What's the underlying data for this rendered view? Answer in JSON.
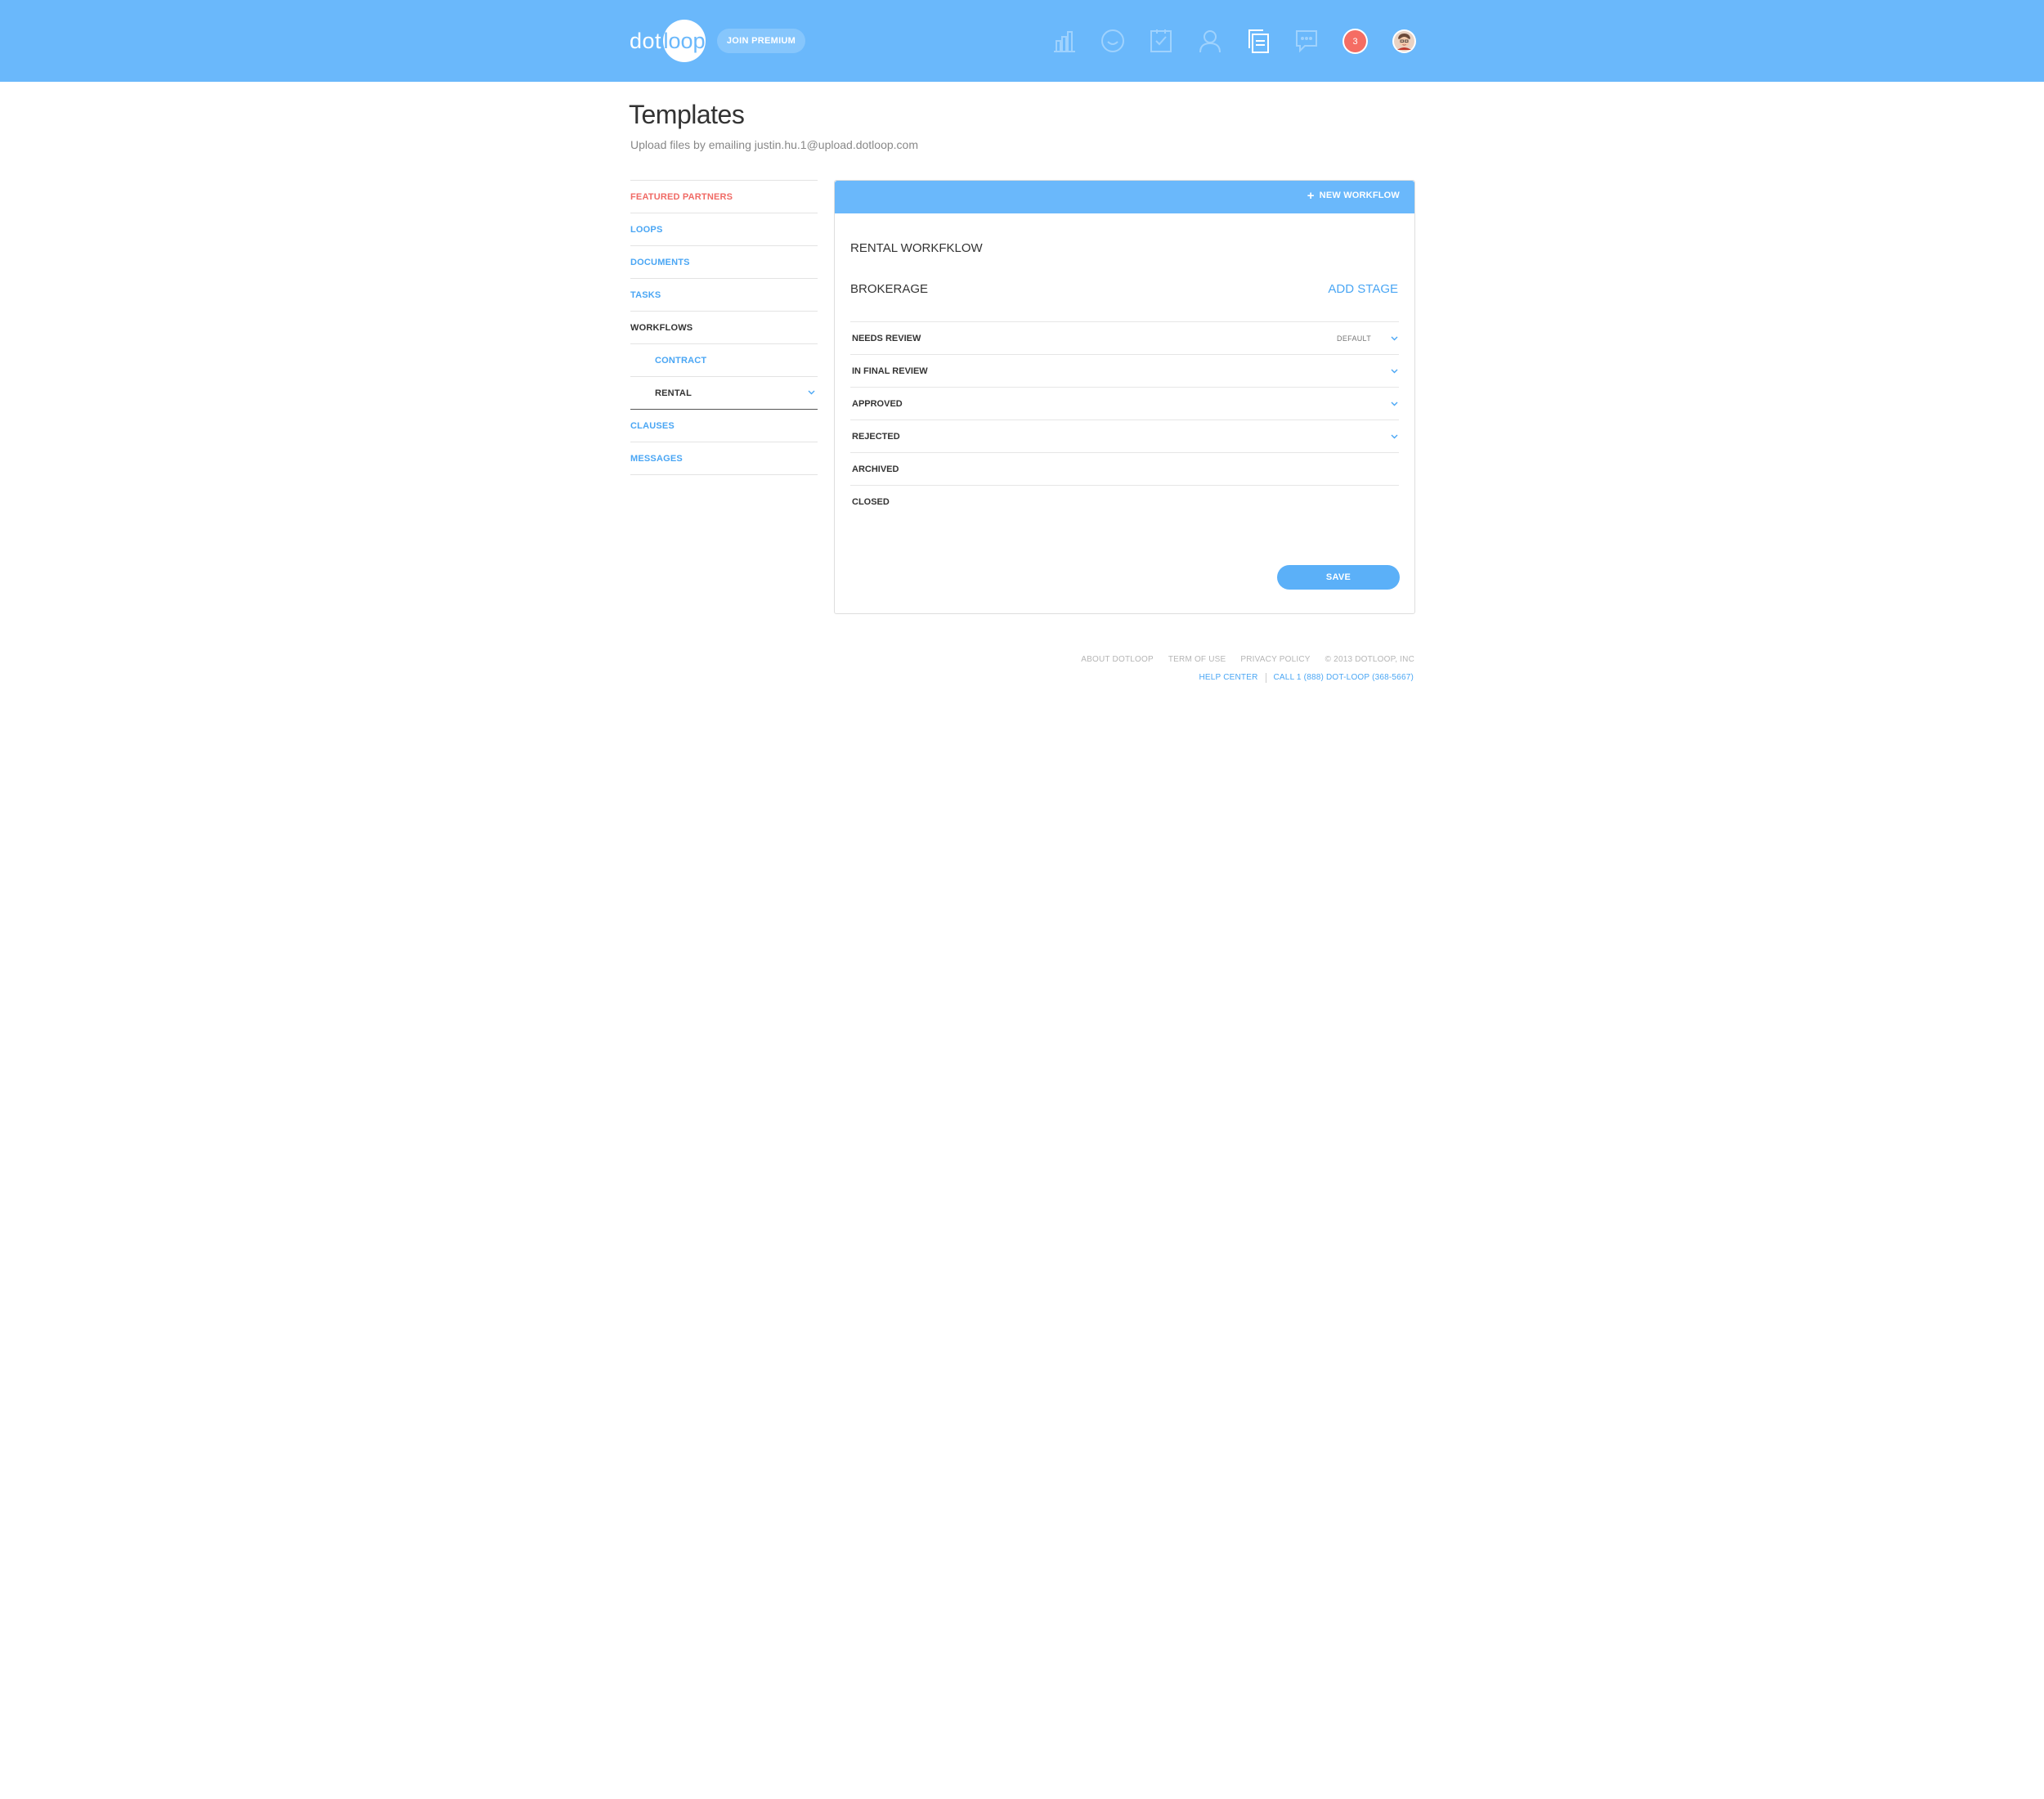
{
  "header": {
    "logo": {
      "left": "dot",
      "right": "loop"
    },
    "join_label": "JOIN PREMIUM",
    "nav_icons": [
      "chart-icon",
      "smiley-icon",
      "task-check-icon",
      "person-icon",
      "documents-icon",
      "chat-icon"
    ],
    "notification_count": "3",
    "accent_color": "#6ab8fb",
    "badge_color": "#f56d63"
  },
  "page": {
    "title": "Templates",
    "subtitle": "Upload files by emailing justin.hu.1@upload.dotloop.com"
  },
  "sidebar": {
    "items": [
      {
        "label": "FEATURED PARTNERS"
      },
      {
        "label": "LOOPS"
      },
      {
        "label": "DOCUMENTS"
      },
      {
        "label": "TASKS"
      },
      {
        "label": "WORKFLOWS"
      },
      {
        "label": "CONTRACT"
      },
      {
        "label": "RENTAL"
      },
      {
        "label": "CLAUSES"
      },
      {
        "label": "MESSAGES"
      }
    ]
  },
  "panel": {
    "new_workflow_label": "NEW WORKFLOW",
    "workflow_title": "RENTAL WORKFKLOW",
    "section_title": "BROKERAGE",
    "add_stage_label": "ADD STAGE",
    "stages": [
      {
        "label": "NEEDS REVIEW",
        "tag": "DEFAULT"
      },
      {
        "label": "IN FINAL REVIEW"
      },
      {
        "label": "APPROVED"
      },
      {
        "label": "REJECTED"
      },
      {
        "label": "ARCHIVED"
      },
      {
        "label": "CLOSED"
      }
    ],
    "save_label": "SAVE"
  },
  "footer": {
    "about": "ABOUT DOTLOOP",
    "terms": "TERM OF USE",
    "privacy": "PRIVACY POLICY",
    "copyright": "© 2013 DOTLOOP, INC",
    "help": "HELP CENTER",
    "phone": "CALL 1 (888) DOT-LOOP (368-5667)"
  }
}
